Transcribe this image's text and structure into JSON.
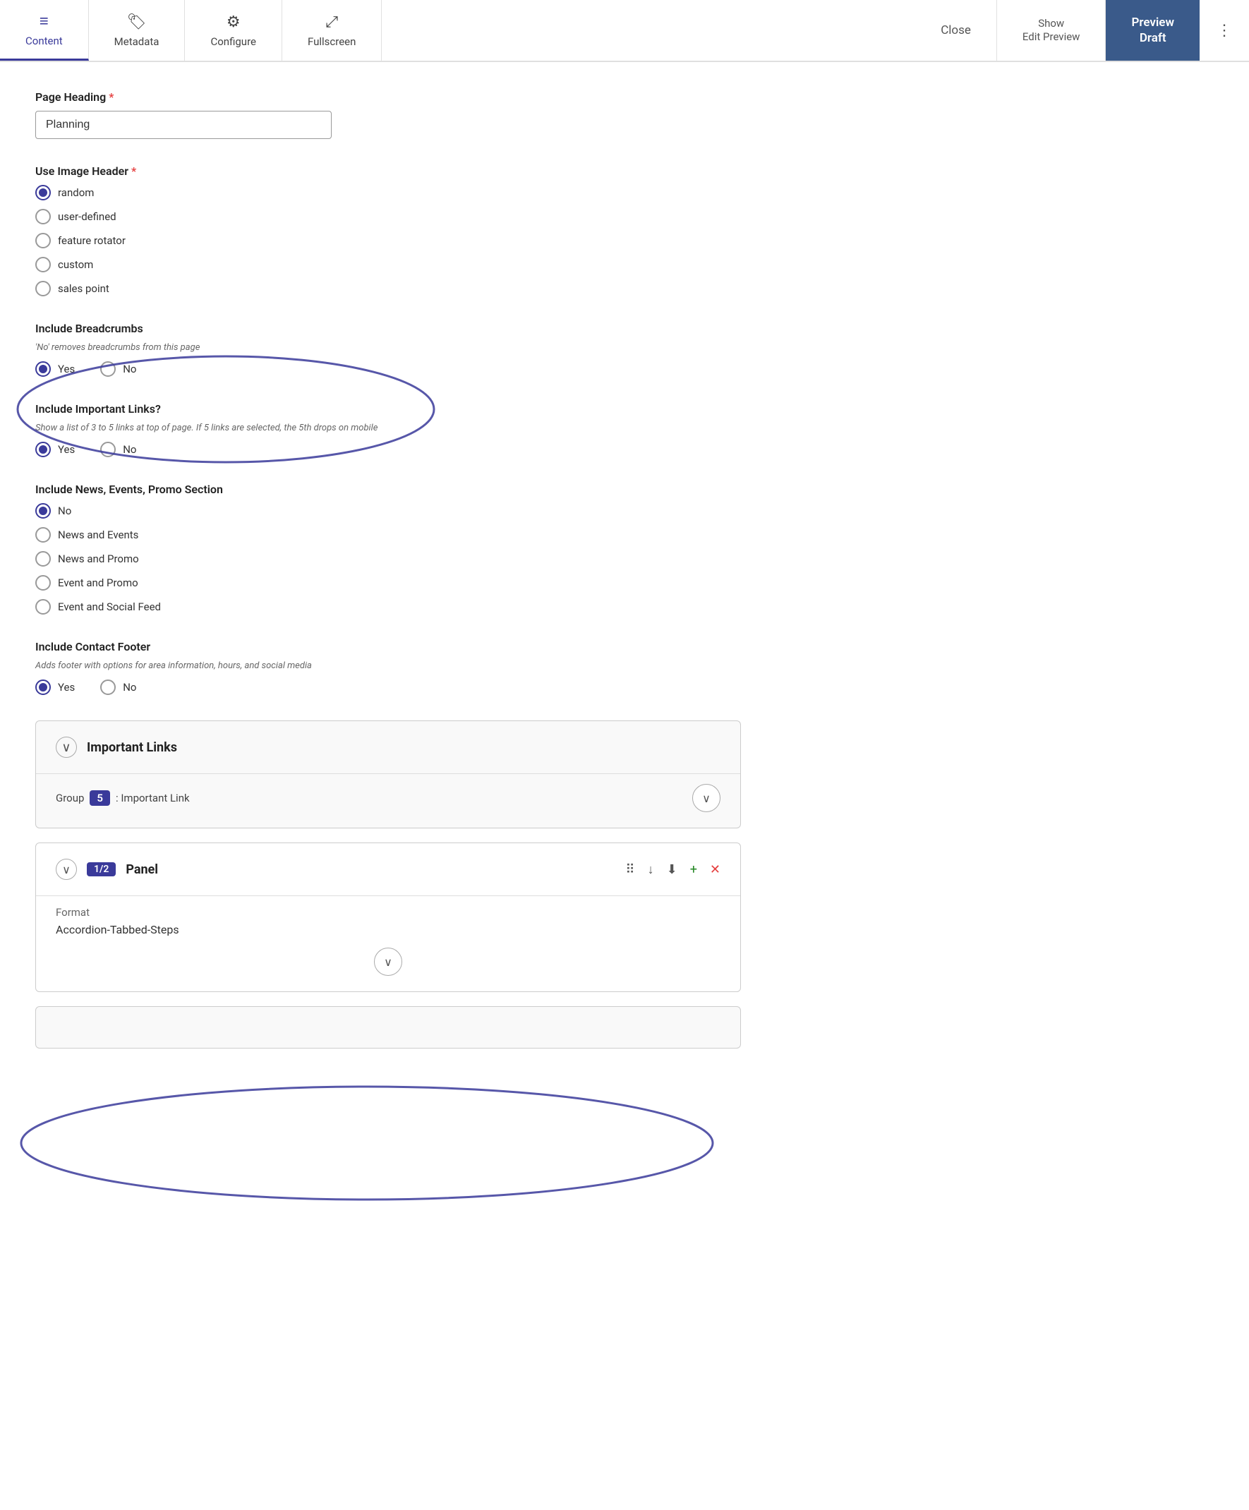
{
  "toolbar": {
    "tabs": [
      {
        "id": "content",
        "label": "Content",
        "icon": "≡",
        "active": true
      },
      {
        "id": "metadata",
        "label": "Metadata",
        "icon": "🏷",
        "active": false
      },
      {
        "id": "configure",
        "label": "Configure",
        "icon": "⚙",
        "active": false
      },
      {
        "id": "fullscreen",
        "label": "Fullscreen",
        "icon": "⤢",
        "active": false
      }
    ],
    "close_label": "Close",
    "show_edit_label": "Show\nEdit Preview",
    "preview_draft_label_line1": "Preview",
    "preview_draft_label_line2": "Draft",
    "more_icon": "⋮"
  },
  "form": {
    "page_heading": {
      "label": "Page Heading",
      "required": true,
      "value": "Planning"
    },
    "use_image_header": {
      "label": "Use Image Header",
      "required": true,
      "options": [
        {
          "value": "random",
          "label": "random",
          "selected": true
        },
        {
          "value": "user-defined",
          "label": "user-defined",
          "selected": false
        },
        {
          "value": "feature rotator",
          "label": "feature rotator",
          "selected": false
        },
        {
          "value": "custom",
          "label": "custom",
          "selected": false
        },
        {
          "value": "sales point",
          "label": "sales point",
          "selected": false
        }
      ]
    },
    "include_breadcrumbs": {
      "label": "Include Breadcrumbs",
      "sublabel": "'No' removes breadcrumbs from this page",
      "options": [
        {
          "value": "yes",
          "label": "Yes",
          "selected": true
        },
        {
          "value": "no",
          "label": "No",
          "selected": false
        }
      ]
    },
    "include_important_links": {
      "label": "Include Important Links?",
      "sublabel": "Show a list of 3 to 5 links at top of page. If 5 links are selected, the 5th drops on mobile",
      "options": [
        {
          "value": "yes",
          "label": "Yes",
          "selected": true
        },
        {
          "value": "no",
          "label": "No",
          "selected": false
        }
      ]
    },
    "include_news_events_promo": {
      "label": "Include News, Events, Promo Section",
      "options": [
        {
          "value": "no",
          "label": "No",
          "selected": true
        },
        {
          "value": "news-and-events",
          "label": "News and Events",
          "selected": false
        },
        {
          "value": "news-and-promo",
          "label": "News and Promo",
          "selected": false
        },
        {
          "value": "event-and-promo",
          "label": "Event and Promo",
          "selected": false
        },
        {
          "value": "event-and-social-feed",
          "label": "Event and Social Feed",
          "selected": false
        }
      ]
    },
    "include_contact_footer": {
      "label": "Include Contact Footer",
      "sublabel": "Adds footer with options for area information, hours, and social media",
      "options": [
        {
          "value": "yes",
          "label": "Yes",
          "selected": true
        },
        {
          "value": "no",
          "label": "No",
          "selected": false
        }
      ]
    }
  },
  "important_links_section": {
    "title": "Important Links",
    "chevron": "∨",
    "group_label": "Group",
    "group_number": "5",
    "group_suffix": ": Important Link"
  },
  "panel_section": {
    "badge": "1/2",
    "title": "Panel",
    "format_label": "Format",
    "format_value": "Accordion-Tabbed-Steps",
    "chevron": "∨"
  }
}
